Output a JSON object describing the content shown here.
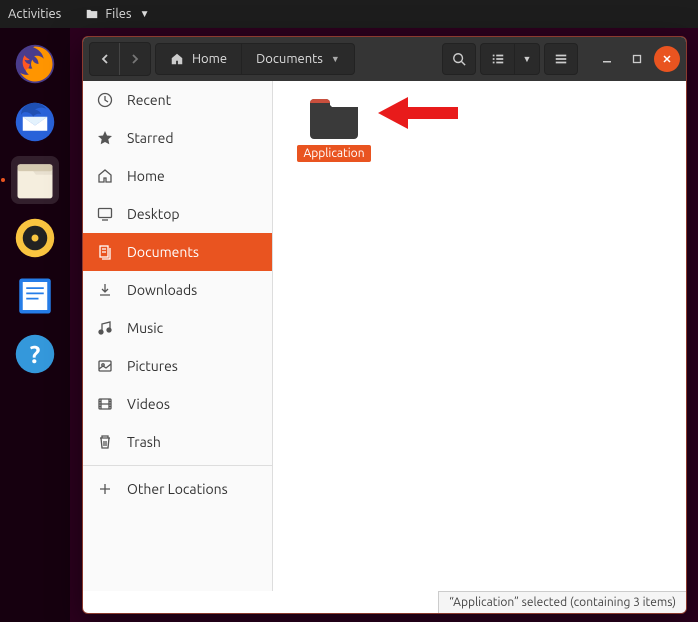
{
  "topbar": {
    "activities": "Activities",
    "files": "Files"
  },
  "dock": {
    "items": [
      {
        "name": "firefox"
      },
      {
        "name": "thunderbird"
      },
      {
        "name": "files",
        "active": true
      },
      {
        "name": "rhythmbox"
      },
      {
        "name": "writer"
      },
      {
        "name": "help"
      }
    ]
  },
  "window": {
    "path": {
      "home_label": "Home",
      "current": "Documents"
    }
  },
  "sidebar": {
    "items": [
      {
        "label": "Recent",
        "icon": "clock"
      },
      {
        "label": "Starred",
        "icon": "star"
      },
      {
        "label": "Home",
        "icon": "home"
      },
      {
        "label": "Desktop",
        "icon": "desktop"
      },
      {
        "label": "Documents",
        "icon": "documents",
        "selected": true
      },
      {
        "label": "Downloads",
        "icon": "downloads"
      },
      {
        "label": "Music",
        "icon": "music"
      },
      {
        "label": "Pictures",
        "icon": "pictures"
      },
      {
        "label": "Videos",
        "icon": "videos"
      },
      {
        "label": "Trash",
        "icon": "trash"
      }
    ],
    "other_locations": "Other Locations"
  },
  "content": {
    "folder_name": "Application"
  },
  "statusbar": {
    "text": "“Application” selected  (containing 3 items)"
  }
}
